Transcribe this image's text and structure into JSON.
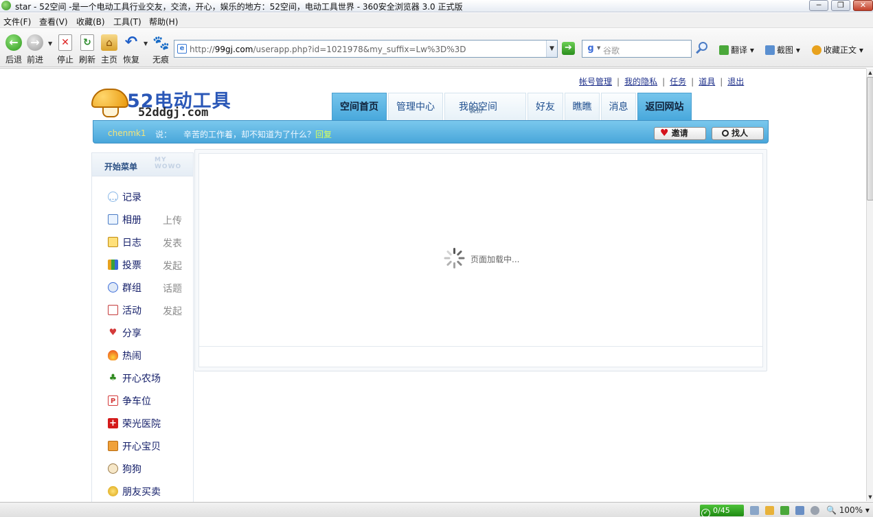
{
  "window": {
    "title": "star - 52空间 -是一个电动工具行业交友，交流，开心，娱乐的地方：52空间，电动工具世界 - 360安全浏览器 3.0 正式版",
    "min_label": "─",
    "max_label": "❐",
    "close_label": "✕"
  },
  "menu": {
    "file": "文件(F)",
    "view": "查看(V)",
    "favorites": "收藏(B)",
    "tools": "工具(T)",
    "help": "帮助(H)"
  },
  "toolbar": {
    "back": "后退",
    "forward": "前进",
    "stop": "停止",
    "refresh": "刷新",
    "home": "主页",
    "restore": "恢复",
    "notrace": "无痕",
    "back_glyph": "←",
    "forward_glyph": "→",
    "stop_glyph": "✕",
    "refresh_glyph": "↻",
    "home_glyph": "⌂",
    "restore_glyph": "↶",
    "notrace_glyph": "🐾"
  },
  "address": {
    "url_prefix": "http://",
    "host": "99gj.com",
    "url_rest": "/userapp.php?id=1021978&my_suffix=Lw%3D%3D"
  },
  "search": {
    "engine_glyph": "g",
    "placeholder": "谷歌"
  },
  "extras": {
    "translate": "翻译",
    "screenshot": "截图",
    "collect_text": "收藏正文"
  },
  "statusbar": {
    "safe_count": "0/45",
    "zoom": "100%"
  },
  "site": {
    "logo_cn": "52电动工具",
    "logo_en": "52ddgj.com",
    "toplinks": [
      "帐号管理",
      "我的隐私",
      "任务",
      "道具",
      "退出"
    ],
    "tabs": {
      "home": "空间首页",
      "manage": "管理中心",
      "myspace": "我的空间",
      "myspace_sub": "装扮",
      "friends": "好友",
      "look": "瞧瞧",
      "messages": "消息",
      "back_site": "返回网站"
    },
    "bar": {
      "username": "chenmk1",
      "says": "说：",
      "message": "辛苦的工作着，却不知道为了什么？",
      "reply": "回复",
      "invite": "邀请",
      "find": "找人"
    },
    "sidebar": {
      "title": "开始菜单",
      "watermark": "MY WOWO",
      "items": [
        {
          "label": "记录",
          "action": ""
        },
        {
          "label": "相册",
          "action": "上传"
        },
        {
          "label": "日志",
          "action": "发表"
        },
        {
          "label": "投票",
          "action": "发起"
        },
        {
          "label": "群组",
          "action": "话题"
        },
        {
          "label": "活动",
          "action": "发起"
        },
        {
          "label": "分享",
          "action": ""
        },
        {
          "label": "热闹",
          "action": ""
        },
        {
          "label": "开心农场",
          "action": ""
        },
        {
          "label": "争车位",
          "action": ""
        },
        {
          "label": "荣光医院",
          "action": ""
        },
        {
          "label": "开心宝贝",
          "action": ""
        },
        {
          "label": "狗狗",
          "action": ""
        },
        {
          "label": "朋友买卖",
          "action": ""
        }
      ]
    },
    "loading": "页面加载中..."
  },
  "colors": {
    "link": "#1d2f8a",
    "tab_active": "#48a8dc",
    "bar": "#49a6da",
    "username": "#f3e47a",
    "reply": "#d9ff5a",
    "menu_text": "#16206a"
  }
}
